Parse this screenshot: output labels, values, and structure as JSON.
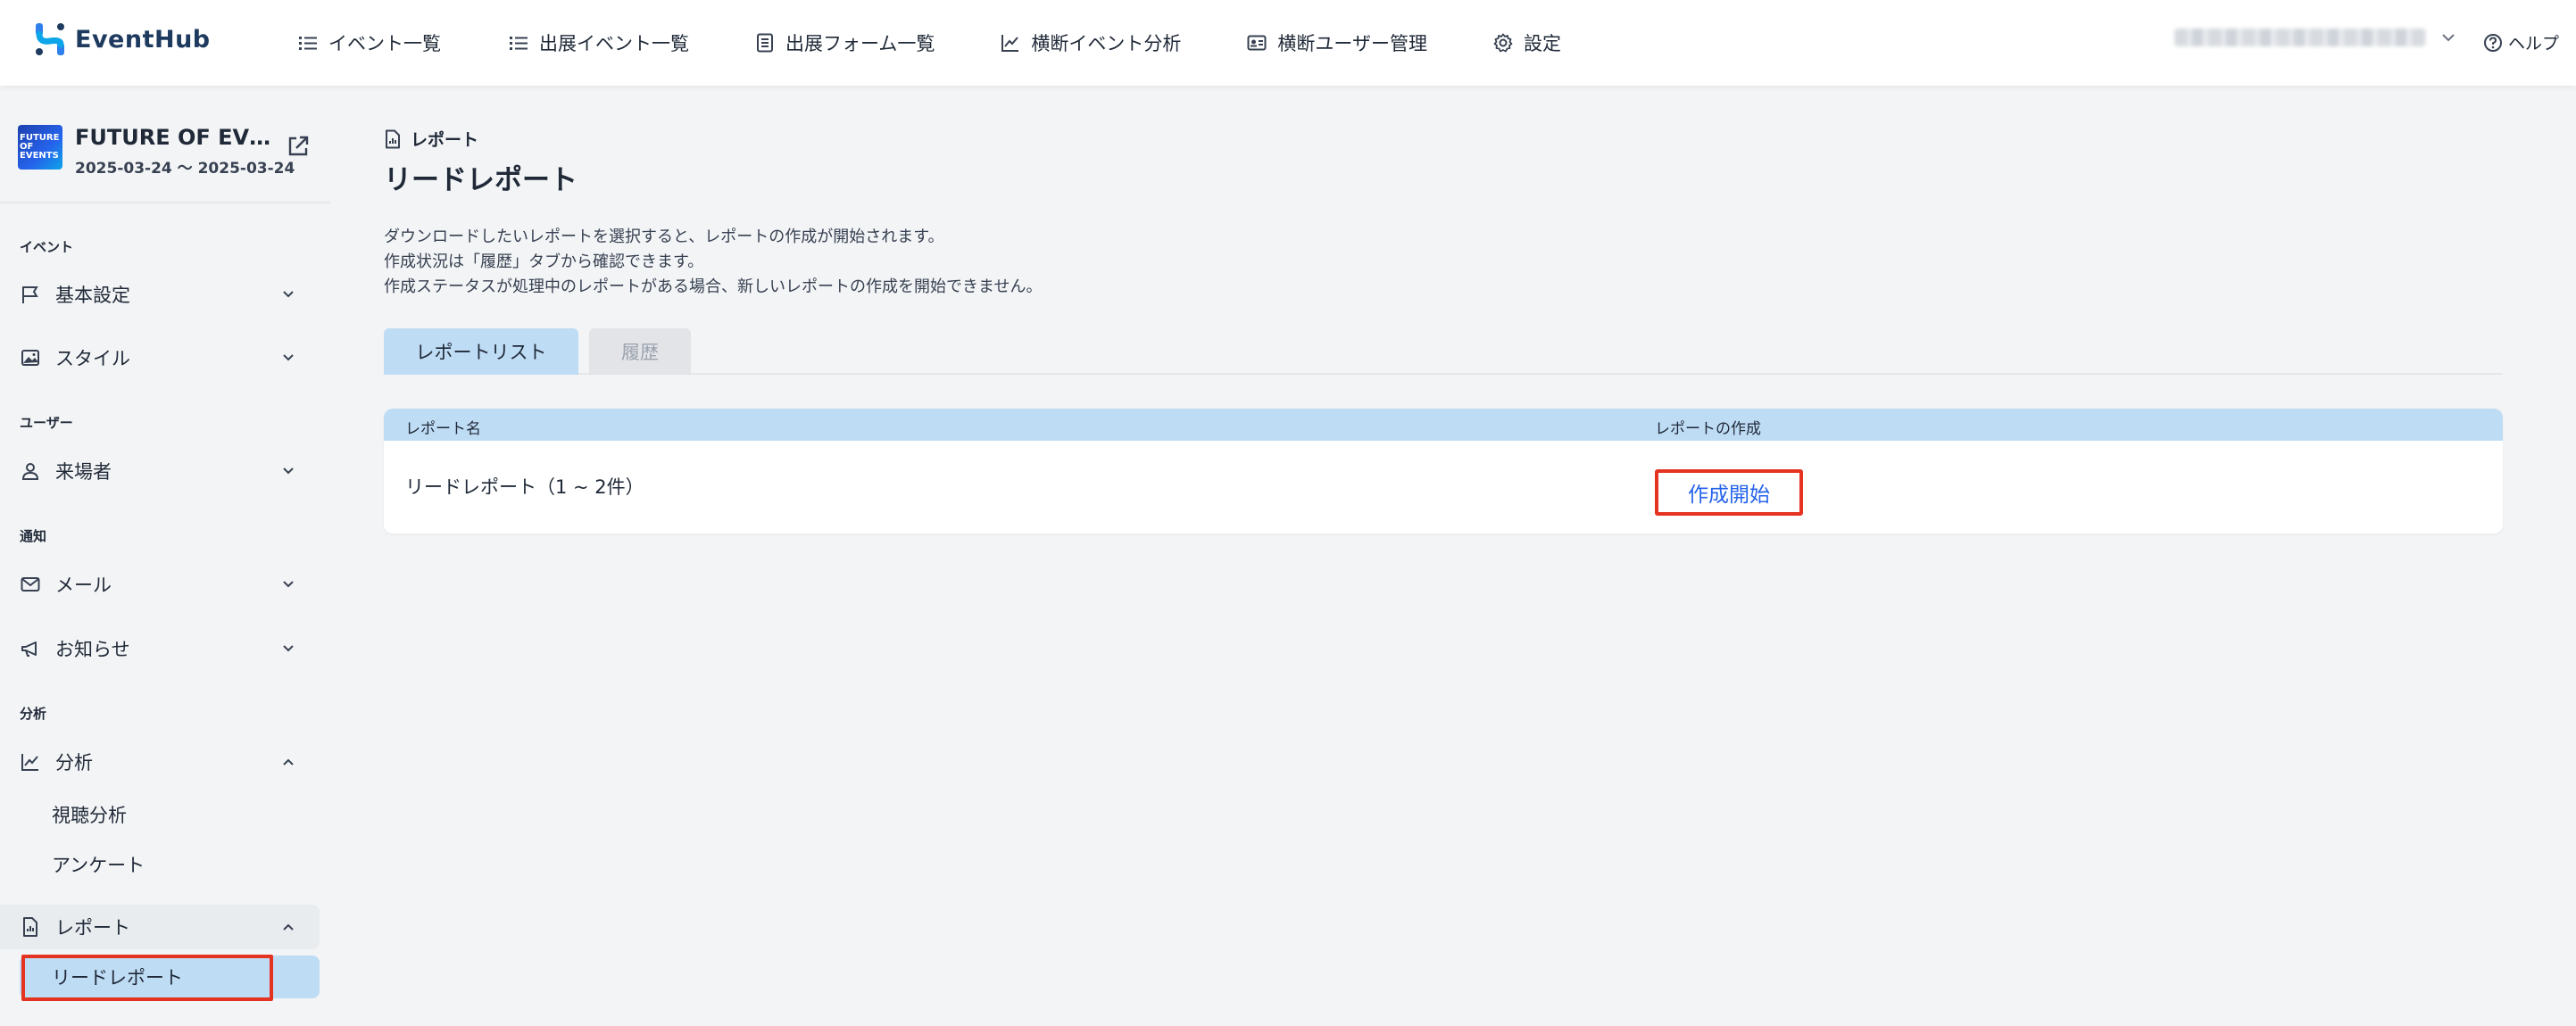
{
  "app": {
    "name": "EventHub"
  },
  "topnav": {
    "items": [
      {
        "label": "イベント一覧",
        "icon": "list-icon"
      },
      {
        "label": "出展イベント一覧",
        "icon": "list-icon"
      },
      {
        "label": "出展フォーム一覧",
        "icon": "form-icon"
      },
      {
        "label": "横断イベント分析",
        "icon": "chart-icon"
      },
      {
        "label": "横断ユーザー管理",
        "icon": "id-card-icon"
      },
      {
        "label": "設定",
        "icon": "gear-icon"
      }
    ],
    "help_label": "ヘルプ"
  },
  "event": {
    "name": "FUTURE OF EVENTS",
    "dates": "2025-03-24 〜 2025-03-24",
    "thumb_lines": [
      "FUTURE",
      "OF EVENTS"
    ]
  },
  "sidebar": {
    "sections": {
      "event": "イベント",
      "user": "ユーザー",
      "notify": "通知",
      "analytics": "分析"
    },
    "items": {
      "basic": "基本設定",
      "style": "スタイル",
      "visitors": "来場者",
      "mail": "メール",
      "news": "お知らせ",
      "analytics": "分析",
      "viewing": "視聴分析",
      "survey": "アンケート",
      "report": "レポート",
      "lead_report": "リードレポート"
    }
  },
  "main": {
    "breadcrumb": "レポート",
    "title": "リードレポート",
    "description": [
      "ダウンロードしたいレポートを選択すると、レポートの作成が開始されます。",
      "作成状況は「履歴」タブから確認できます。",
      "作成ステータスが処理中のレポートがある場合、新しいレポートの作成を開始できません。"
    ],
    "tabs": {
      "list": "レポートリスト",
      "history": "履歴"
    },
    "table": {
      "headers": {
        "name": "レポート名",
        "create": "レポートの作成"
      },
      "rows": [
        {
          "name": "リードレポート（1 ~ 2件）",
          "action": "作成開始"
        }
      ]
    }
  },
  "colors": {
    "accent": "#bfdcf5",
    "highlight": "#e53322",
    "link": "#2563eb",
    "background": "#f3f4f6"
  }
}
